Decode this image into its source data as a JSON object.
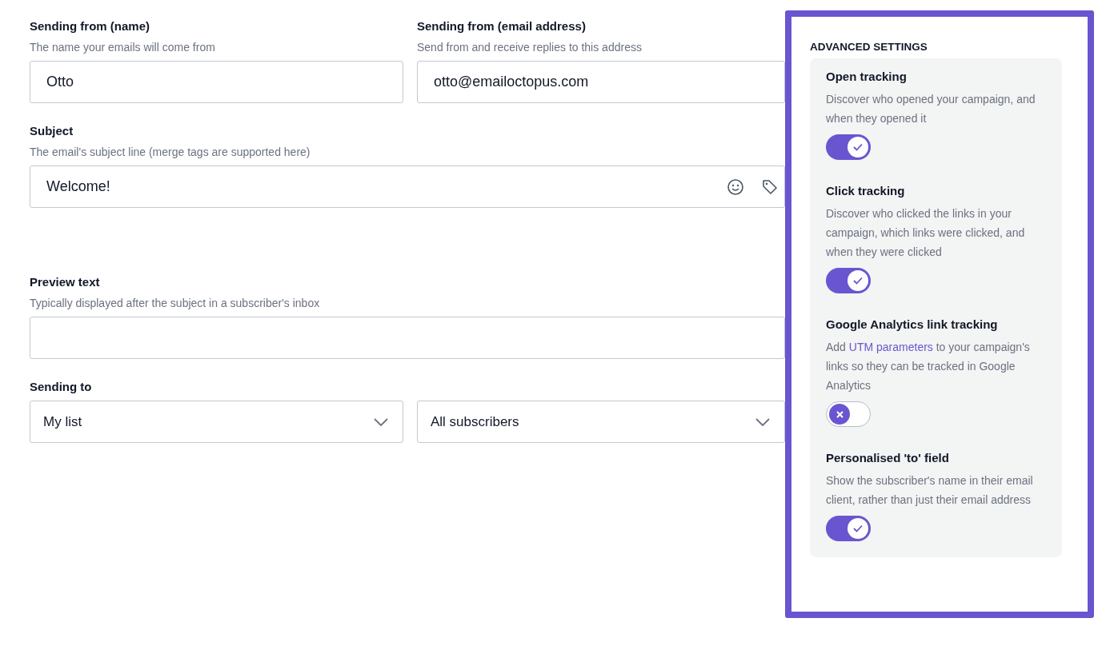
{
  "form": {
    "sender_name": {
      "label": "Sending from (name)",
      "hint": "The name your emails will come from",
      "value": "Otto"
    },
    "sender_email": {
      "label": "Sending from (email address)",
      "hint": "Send from and receive replies to this address",
      "value": "otto@emailoctopus.com"
    },
    "subject": {
      "label": "Subject",
      "hint": "The email's subject line (merge tags are supported here)",
      "value": "Welcome!"
    },
    "preview_text": {
      "label": "Preview text",
      "hint": "Typically displayed after the subject in a subscriber's inbox"
    },
    "sending_to": {
      "label": "Sending to",
      "list": "My list",
      "segment": "All subscribers"
    }
  },
  "advanced_settings": {
    "title": "ADVANCED SETTINGS",
    "items": [
      {
        "title": "Open tracking",
        "description": [
          {
            "kind": "text",
            "text": "Discover who opened your campaign, and when they opened it"
          }
        ],
        "on": true
      },
      {
        "title": "Click tracking",
        "description": [
          {
            "kind": "text",
            "text": "Discover who clicked the links in your campaign, which links were clicked, and when they were clicked"
          }
        ],
        "on": true
      },
      {
        "title": "Google Analytics link tracking",
        "description": [
          {
            "kind": "text",
            "text": "Add "
          },
          {
            "kind": "link",
            "text": "UTM parameters"
          },
          {
            "kind": "text",
            "text": " to your campaign's links so they can be tracked in Google Analytics"
          }
        ],
        "on": false
      },
      {
        "title": "Personalised 'to' field",
        "description": [
          {
            "kind": "text",
            "text": "Show the subscriber's name in their email client, rather than just their email address"
          }
        ],
        "on": true
      }
    ]
  }
}
